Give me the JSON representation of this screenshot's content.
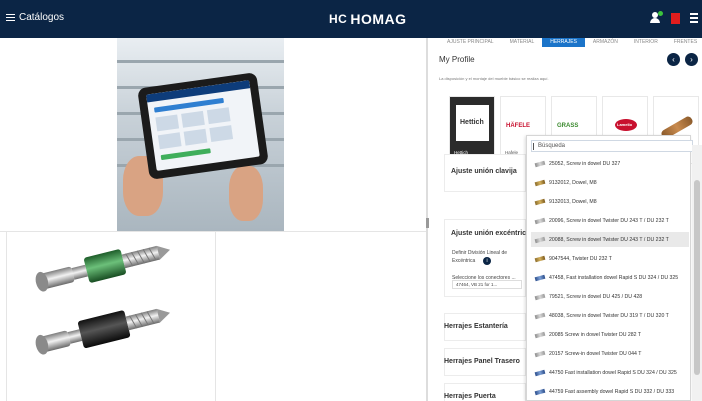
{
  "topbar": {
    "menu_label": "Catálogos",
    "logo_text": "HOMAG",
    "logo_mark": "HC"
  },
  "right_panel": {
    "tabs": [
      {
        "label": "AJUSTE PRINCIPAL",
        "active": false
      },
      {
        "label": "MATERIAL",
        "active": false
      },
      {
        "label": "HERRAJES",
        "active": true
      },
      {
        "label": "ARMAZÓN",
        "active": false
      },
      {
        "label": "INTERIOR",
        "active": false
      },
      {
        "label": "FRENTES",
        "active": false
      }
    ],
    "title": "My Profile",
    "description": "La disposición y el montaje del mueble básico se realiza aquí.",
    "brands": [
      {
        "name": "Hettich",
        "logo": "Hettich",
        "active": true
      },
      {
        "name": "Hafele",
        "logo": "HÄFELE",
        "active": false
      },
      {
        "name": "",
        "logo": "GRASS",
        "active": false
      },
      {
        "name": "",
        "logo": "Lamello",
        "active": false
      },
      {
        "name": "",
        "logo": "",
        "active": false
      }
    ],
    "sections": {
      "ajuste_clavija": "Ajuste unión clavija",
      "ajuste_excentrica": "Ajuste unión excéntrica",
      "definir_label": "Definir División Lineal de Excéntrica",
      "seleccione_label": "Seleccione los conectores ...",
      "select_value": "47464, VB 21 for 1...",
      "herrajes_estanteria": "Herrajes Estantería",
      "herrajes_panel_trasero": "Herrajes Panel Trasero",
      "herrajes_puerta": "Herrajes Puerta"
    }
  },
  "dropdown": {
    "placeholder": "Búsqueda",
    "items": [
      {
        "label": "25052, Screw in dowel DU 327",
        "thumb": "metal",
        "highlighted": false
      },
      {
        "label": "9132012, Dowel, M8",
        "thumb": "gold",
        "highlighted": false
      },
      {
        "label": "9132013, Dowel, M8",
        "thumb": "gold",
        "highlighted": false
      },
      {
        "label": "20096, Screw in dowel Twister DU 243 T / DU 232 T",
        "thumb": "metal",
        "highlighted": false
      },
      {
        "label": "20088, Screw in dowel Twister DU 243 T / DU 232 T",
        "thumb": "metal",
        "highlighted": true
      },
      {
        "label": "9047544, Twister DU 232 T",
        "thumb": "gold",
        "highlighted": false
      },
      {
        "label": "47458, Fast installation dowel Rapid S DU 324 / DU 325",
        "thumb": "blue",
        "highlighted": false
      },
      {
        "label": "79521, Screw in dowel DU 425 / DU 428",
        "thumb": "metal",
        "highlighted": false
      },
      {
        "label": "48038, Screw in dowel Twister DU 319 T / DU 320 T",
        "thumb": "metal",
        "highlighted": false
      },
      {
        "label": "20085 Screw in dowel Twister DU 282 T",
        "thumb": "metal",
        "highlighted": false
      },
      {
        "label": "20157 Screw-in dowel Twister DU 044 T",
        "thumb": "metal",
        "highlighted": false
      },
      {
        "label": "44750 Fast installation dowel Rapid S DU 324 / DU 325",
        "thumb": "blue",
        "highlighted": false
      },
      {
        "label": "44759 Fast assembly dowel Rapid S DU 332 / DU 333",
        "thumb": "blue",
        "highlighted": false
      }
    ]
  },
  "colors": {
    "topbar": "#0b2545",
    "tab_active": "#1b74c9",
    "status_green": "#3cc43c",
    "flag_red": "#e21d1d"
  }
}
